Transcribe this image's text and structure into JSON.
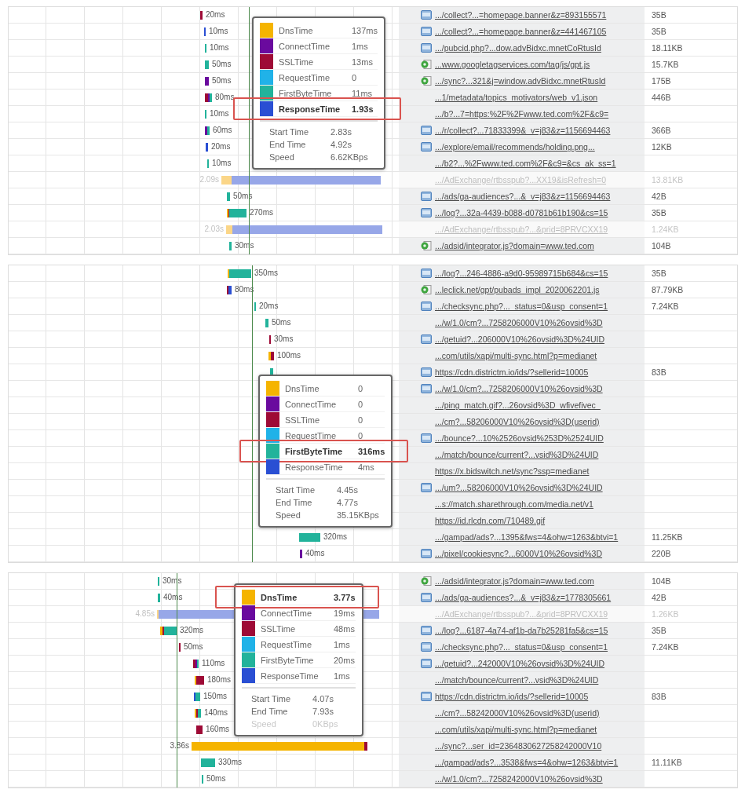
{
  "panels": [
    {
      "rows": [
        {
          "kind": "image",
          "duration": "20ms",
          "url": ".../collect?...=homepage.banner&z=893155571",
          "size": "35B",
          "dimmed": false
        },
        {
          "kind": "image",
          "duration": "10ms",
          "url": ".../collect?...=homepage.banner&z=441467105",
          "size": "35B",
          "dimmed": false
        },
        {
          "kind": "image",
          "duration": "10ms",
          "url": ".../pubcid.php?...dow.advBidxc.mnetCoRtusId",
          "size": "18.11KB",
          "dimmed": false
        },
        {
          "kind": "script",
          "duration": "50ms",
          "url": "...www.googletagservices.com/tag/js/gpt.js",
          "size": "15.7KB",
          "dimmed": false
        },
        {
          "kind": "script",
          "duration": "50ms",
          "url": ".../sync?...321&j=window.advBidxc.mnetRtusId",
          "size": "175B",
          "dimmed": false
        },
        {
          "kind": "plain",
          "duration": "80ms",
          "url": "...1/metadata/topics_motivators/web_v1.json",
          "size": "446B",
          "dimmed": false
        },
        {
          "kind": "plain",
          "duration": "10ms",
          "url": ".../b?...7=https:%2F%2Fwww.ted.com%2F&c9=",
          "dimmed": false
        },
        {
          "kind": "image",
          "duration": "60ms",
          "url": ".../r/collect?...71833399&_v=j83&z=1156694463",
          "size": "366B",
          "dimmed": false
        },
        {
          "kind": "image",
          "duration": "20ms",
          "url": ".../explore/email/recommends/holding.png...",
          "size": "12KB",
          "dimmed": false
        },
        {
          "kind": "plain",
          "duration": "10ms",
          "url": ".../b2?...%2Fwww.ted.com%2F&c9=&cs_ak_ss=1",
          "dimmed": false
        },
        {
          "kind": "plain",
          "duration": "2.09s",
          "url": ".../AdExchange/rtbsspub?...XX19&isRefresh=0",
          "size": "13.81KB",
          "dimmed": true
        },
        {
          "kind": "image",
          "duration": "50ms",
          "url": ".../ads/ga-audiences?...&_v=j83&z=1156694463",
          "size": "42B",
          "dimmed": false
        },
        {
          "kind": "image",
          "duration": "270ms",
          "url": ".../log?...32a-4439-b088-d0781b61b190&cs=15",
          "size": "35B",
          "dimmed": false
        },
        {
          "kind": "plain",
          "duration": "2.03s",
          "url": ".../AdExchange/rtbsspub?...&prid=8PRVCXX19",
          "size": "1.24KB",
          "dimmed": true
        },
        {
          "kind": "script",
          "duration": "30ms",
          "url": ".../adsid/integrator.js?domain=www.ted.com",
          "size": "104B",
          "dimmed": false
        }
      ],
      "tooltip": {
        "phases": [
          {
            "name": "DnsTime",
            "value": "137ms",
            "color": "#f5b400",
            "highlighted": false
          },
          {
            "name": "ConnectTime",
            "value": "1ms",
            "color": "#6a0a9e",
            "highlighted": false
          },
          {
            "name": "SSLTime",
            "value": "13ms",
            "color": "#9e0a36",
            "highlighted": false
          },
          {
            "name": "RequestTime",
            "value": "0",
            "color": "#20b2e8",
            "highlighted": false
          },
          {
            "name": "FirstByteTime",
            "value": "11ms",
            "color": "#22b39b",
            "highlighted": false
          },
          {
            "name": "ResponseTime",
            "value": "1.93s",
            "color": "#2a4fd3",
            "highlighted": true
          }
        ],
        "stats": [
          {
            "label": "Start Time",
            "value": "2.83s",
            "dimmed": false
          },
          {
            "label": "End Time",
            "value": "4.92s",
            "dimmed": false
          },
          {
            "label": "Speed",
            "value": "6.62KBps",
            "dimmed": false
          }
        ]
      }
    },
    {
      "rows": [
        {
          "kind": "image",
          "duration": "350ms",
          "url": ".../log?...246-4886-a9d0-95989715b684&cs=15",
          "size": "35B",
          "dimmed": false
        },
        {
          "kind": "script",
          "duration": "80ms",
          "url": "...leclick.net/gpt/pubads_impl_2020062201.js",
          "size": "87.79KB",
          "dimmed": false
        },
        {
          "kind": "image",
          "duration": "20ms",
          "url": ".../checksync.php?..._status=0&usp_consent=1",
          "size": "7.24KB",
          "dimmed": false
        },
        {
          "kind": "plain",
          "duration": "50ms",
          "url": ".../w/1.0/cm?...7258206000V10%26ovsid%3D",
          "dimmed": false
        },
        {
          "kind": "image",
          "duration": "30ms",
          "url": ".../getuid?...206000V10%26ovsid%3D%24UID",
          "dimmed": false
        },
        {
          "kind": "plain",
          "duration": "100ms",
          "url": "...com/utils/xapi/multi-sync.html?p=medianet",
          "dimmed": false
        },
        {
          "kind": "image",
          "url": "https://cdn.districtm.io/ids/?sellerid=10005",
          "size": "83B",
          "dimmed": false
        },
        {
          "kind": "image",
          "url": ".../w/1.0/cm?...7258206000V10%26ovsid%3D",
          "dimmed": false
        },
        {
          "kind": "plain",
          "url": ".../ping_match.gif?...26ovsid%3D_wfivefivec_",
          "dimmed": false
        },
        {
          "kind": "plain",
          "url": ".../cm?...58206000V10%26ovsid%3D(userid)",
          "dimmed": false
        },
        {
          "kind": "image",
          "url": ".../bounce?...10%2526ovsid%253D%2524UID",
          "dimmed": false
        },
        {
          "kind": "plain",
          "url": ".../match/bounce/current?...vsid%3D%24UID",
          "dimmed": false
        },
        {
          "kind": "plain",
          "url": "https://x.bidswitch.net/sync?ssp=medianet",
          "dimmed": false
        },
        {
          "kind": "image",
          "url": ".../um?...58206000V10%26ovsid%3D%24UID",
          "dimmed": false
        },
        {
          "kind": "plain",
          "url": "...s://match.sharethrough.com/media.net/v1",
          "dimmed": false
        },
        {
          "kind": "plain",
          "url": "https://id.rlcdn.com/710489.gif",
          "dimmed": false
        },
        {
          "kind": "plain",
          "duration": "320ms",
          "url": ".../gampad/ads?...1395&fws=4&ohw=1263&btvi=1",
          "size": "11.25KB",
          "dimmed": false
        },
        {
          "kind": "image",
          "duration": "40ms",
          "url": ".../pixel/cookiesync?...6000V10%26ovsid%3D",
          "size": "220B",
          "dimmed": false
        }
      ],
      "tooltip": {
        "phases": [
          {
            "name": "DnsTime",
            "value": "0",
            "color": "#f5b400",
            "highlighted": false
          },
          {
            "name": "ConnectTime",
            "value": "0",
            "color": "#6a0a9e",
            "highlighted": false
          },
          {
            "name": "SSLTime",
            "value": "0",
            "color": "#9e0a36",
            "highlighted": false
          },
          {
            "name": "RequestTime",
            "value": "0",
            "color": "#20b2e8",
            "highlighted": false
          },
          {
            "name": "FirstByteTime",
            "value": "316ms",
            "color": "#22b39b",
            "highlighted": true
          },
          {
            "name": "ResponseTime",
            "value": "4ms",
            "color": "#2a4fd3",
            "highlighted": false
          }
        ],
        "stats": [
          {
            "label": "Start Time",
            "value": "4.45s",
            "dimmed": false
          },
          {
            "label": "End Time",
            "value": "4.77s",
            "dimmed": false
          },
          {
            "label": "Speed",
            "value": "35.15KBps",
            "dimmed": false
          }
        ]
      }
    },
    {
      "rows": [
        {
          "kind": "script",
          "duration": "30ms",
          "url": ".../adsid/integrator.js?domain=www.ted.com",
          "size": "104B",
          "dimmed": false
        },
        {
          "kind": "image",
          "duration": "40ms",
          "url": ".../ads/ga-audiences?...&_v=j83&z=1778305661",
          "size": "42B",
          "dimmed": false
        },
        {
          "kind": "plain",
          "duration": "4.85s",
          "url": ".../AdExchange/rtbsspub?...&prid=8PRVCXX19",
          "size": "1.26KB",
          "dimmed": true
        },
        {
          "kind": "image",
          "duration": "320ms",
          "url": ".../log?...6187-4a74-af1b-da7b25281fa5&cs=15",
          "size": "35B",
          "dimmed": false
        },
        {
          "kind": "image",
          "duration": "50ms",
          "url": ".../checksync.php?..._status=0&usp_consent=1",
          "size": "7.24KB",
          "dimmed": false
        },
        {
          "kind": "image",
          "duration": "110ms",
          "url": ".../getuid?...242000V10%26ovsid%3D%24UID",
          "dimmed": false
        },
        {
          "kind": "plain",
          "duration": "180ms",
          "url": ".../match/bounce/current?...vsid%3D%24UID",
          "dimmed": false
        },
        {
          "kind": "image",
          "duration": "150ms",
          "url": "https://cdn.districtm.io/ids/?sellerid=10005",
          "size": "83B",
          "dimmed": false
        },
        {
          "kind": "plain",
          "duration": "140ms",
          "url": ".../cm?...58242000V10%26ovsid%3D(userid)",
          "dimmed": false
        },
        {
          "kind": "plain",
          "duration": "160ms",
          "url": "...com/utils/xapi/multi-sync.html?p=medianet",
          "dimmed": false
        },
        {
          "kind": "plain",
          "duration": "3.86s",
          "url": ".../sync?...ser_id=2364830627258242000V10",
          "dimmed": false
        },
        {
          "kind": "plain",
          "duration": "330ms",
          "url": ".../gampad/ads?...3538&fws=4&ohw=1263&btvi=1",
          "size": "11.11KB",
          "dimmed": false
        },
        {
          "kind": "plain",
          "duration": "50ms",
          "url": ".../w/1.0/cm?...7258242000V10%26ovsid%3D",
          "dimmed": false
        }
      ],
      "tooltip": {
        "phases": [
          {
            "name": "DnsTime",
            "value": "3.77s",
            "color": "#f5b400",
            "highlighted": true
          },
          {
            "name": "ConnectTime",
            "value": "19ms",
            "color": "#6a0a9e",
            "highlighted": false
          },
          {
            "name": "SSLTime",
            "value": "48ms",
            "color": "#9e0a36",
            "highlighted": false
          },
          {
            "name": "RequestTime",
            "value": "1ms",
            "color": "#20b2e8",
            "highlighted": false
          },
          {
            "name": "FirstByteTime",
            "value": "20ms",
            "color": "#22b39b",
            "highlighted": false
          },
          {
            "name": "ResponseTime",
            "value": "1ms",
            "color": "#2a4fd3",
            "highlighted": false
          }
        ],
        "stats": [
          {
            "label": "Start Time",
            "value": "4.07s",
            "dimmed": false
          },
          {
            "label": "End Time",
            "value": "7.93s",
            "dimmed": false
          },
          {
            "label": "Speed",
            "value": "0KBps",
            "dimmed": true
          }
        ]
      }
    }
  ]
}
